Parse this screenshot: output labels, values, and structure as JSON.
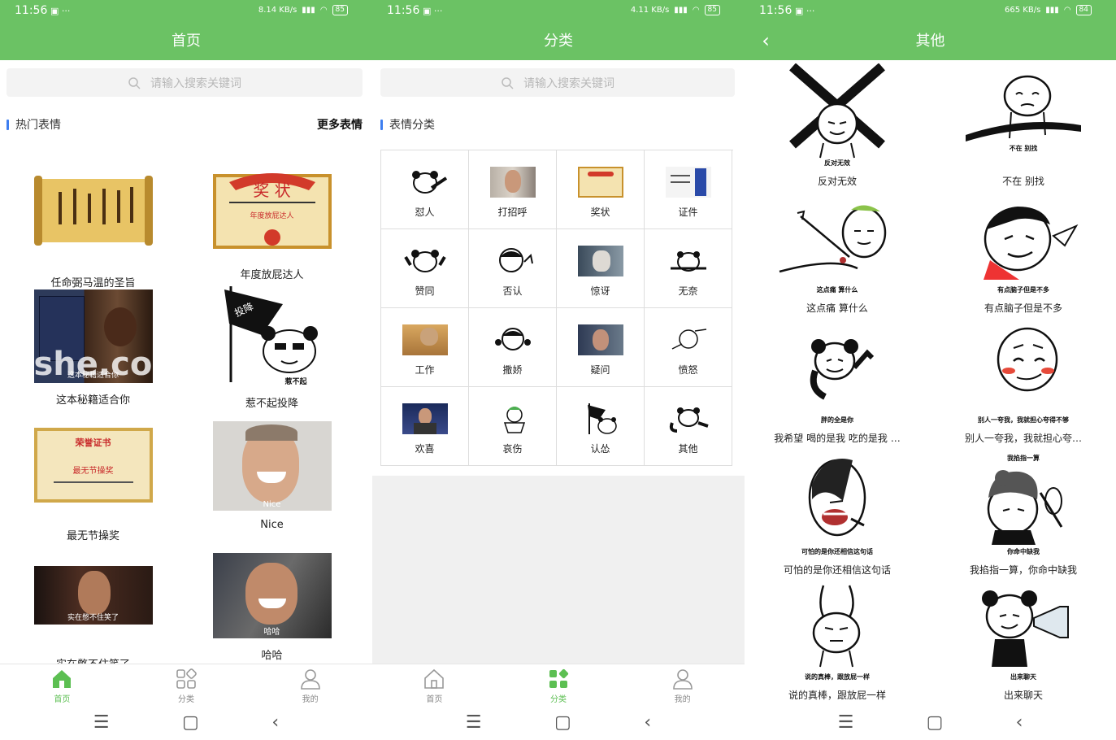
{
  "status": {
    "time": "11:56",
    "extras": "▣ ···",
    "p1_net": "8.14 KB/s",
    "p2_net": "4.11 KB/s",
    "p3_net": "665 KB/s",
    "p1_batt": "85",
    "p2_batt": "85",
    "p3_batt": "84"
  },
  "home": {
    "title": "首页",
    "search_placeholder": "请输入搜索关键词",
    "section": "热门表情",
    "more": "更多表情",
    "items": [
      {
        "label": "任命弼马温的圣旨"
      },
      {
        "label": "年度放屁达人",
        "thumb_text": "奖 状",
        "sub": "年度放屁达人"
      },
      {
        "label": "这本秘籍适合你",
        "overlay": "这本秘籍适合你"
      },
      {
        "label": "惹不起投降",
        "flag": "投降",
        "overlay": "惹不起"
      },
      {
        "label": "最无节操奖",
        "thumb_text": "荣誉证书",
        "sub": "最无节操奖"
      },
      {
        "label": "Nice",
        "overlay": "Nice"
      },
      {
        "label": "实在憋不住笑了",
        "overlay": "实在憋不住笑了"
      },
      {
        "label": "哈哈",
        "overlay": "哈哈"
      }
    ]
  },
  "category": {
    "title": "分类",
    "search_placeholder": "请输入搜索关键词",
    "section": "表情分类",
    "items": [
      "怼人",
      "打招呼",
      "奖状",
      "证件",
      "赞同",
      "否认",
      "惊讶",
      "无奈",
      "工作",
      "撒娇",
      "疑问",
      "愤怒",
      "欢喜",
      "哀伤",
      "认怂",
      "其他"
    ]
  },
  "other": {
    "title": "其他",
    "items": [
      {
        "label": "反对无效",
        "cap": "反对无效"
      },
      {
        "label": "不在 别找",
        "cap": "不在 别找"
      },
      {
        "label": "这点痛 算什么",
        "cap": "这点痛 算什么"
      },
      {
        "label": "有点脑子但是不多",
        "cap": "有点脑子但是不多"
      },
      {
        "label": "我希望 喝的是我 吃的是我 …",
        "cap": "胖的全是你"
      },
      {
        "label": "别人一夸我，我就担心夸…",
        "cap": "别人一夸我，我就担心夸得不够"
      },
      {
        "label": "可怕的是你还相信这句话",
        "cap": "可怕的是你还相信这句话"
      },
      {
        "label": "我掐指一算，你命中缺我",
        "cap": "你命中缺我"
      },
      {
        "label": "说的真棒，跟放屁一样",
        "cap": "说的真棒，跟放屁一样"
      },
      {
        "label": "出来聊天",
        "cap": "出来聊天"
      }
    ]
  },
  "nav": {
    "home": "首页",
    "category": "分类",
    "mine": "我的"
  },
  "colors": {
    "primary": "#6bc264",
    "accent": "#3d7ef0"
  }
}
